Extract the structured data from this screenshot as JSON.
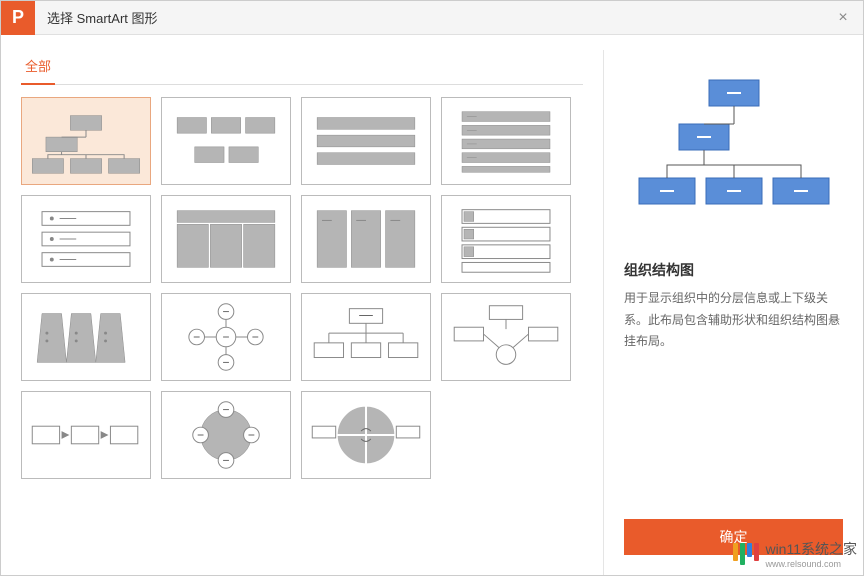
{
  "titlebar": {
    "title": "选择 SmartArt 图形",
    "close": "×"
  },
  "tabs": {
    "all": "全部"
  },
  "info": {
    "title": "组织结构图",
    "desc": "用于显示组织中的分层信息或上下级关系。此布局包含辅助形状和组织结构图悬挂布局。"
  },
  "footer": {
    "ok": "确定"
  },
  "watermark": {
    "brand": "win11系统之家",
    "url": "www.relsound.com"
  },
  "colors": {
    "accent": "#e95b2b",
    "blue": "#5a8ed8",
    "gray": "#b5b5b5"
  }
}
